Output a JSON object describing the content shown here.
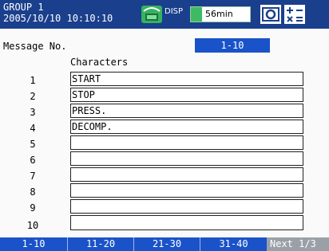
{
  "header": {
    "group_title": "GROUP 1",
    "datetime": "2005/10/10 10:10:10",
    "disp_label": "DISP",
    "time_remaining": "56min",
    "icons": [
      "memory-icon",
      "camera-icon",
      "math-icon"
    ]
  },
  "settings": {
    "message_no_label": "Message No.",
    "message_no_value": "1-10",
    "characters_label": "Characters",
    "rows": [
      {
        "num": "1",
        "text": "START"
      },
      {
        "num": "2",
        "text": "STOP"
      },
      {
        "num": "3",
        "text": "PRESS."
      },
      {
        "num": "4",
        "text": "DECOMP."
      },
      {
        "num": "5",
        "text": ""
      },
      {
        "num": "6",
        "text": ""
      },
      {
        "num": "7",
        "text": ""
      },
      {
        "num": "8",
        "text": ""
      },
      {
        "num": "9",
        "text": ""
      },
      {
        "num": "10",
        "text": ""
      }
    ]
  },
  "softkeys": {
    "keys": [
      "1-10",
      "11-20",
      "21-30",
      "31-40"
    ],
    "next": "Next 1/3"
  },
  "colors": {
    "header_bg": "#1a3f8c",
    "accent_blue": "#1a53c9",
    "status_green": "#3dbb64",
    "softkey_next_bg": "#9aa0a8"
  }
}
